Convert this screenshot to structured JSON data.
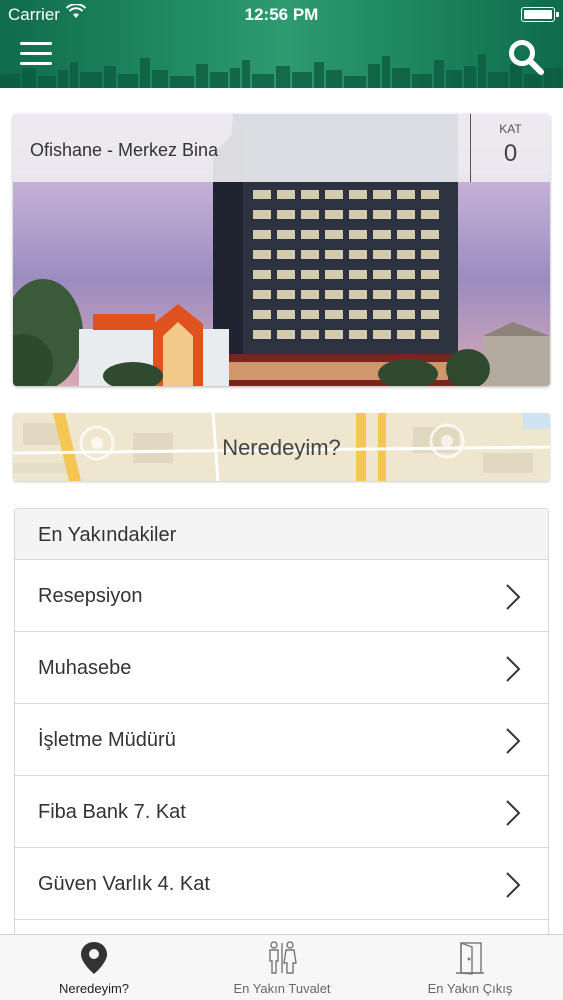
{
  "status_bar": {
    "carrier": "Carrier",
    "time": "12:56 PM"
  },
  "header": {
    "menu_icon": "hamburger-icon",
    "search_icon": "search-icon"
  },
  "building": {
    "name": "Ofishane - Merkez Bina",
    "floor_label": "KAT",
    "floor_value": "0"
  },
  "where_banner": {
    "label": "Neredeyim?"
  },
  "nearest": {
    "title": "En Yakındakiler",
    "items": [
      {
        "label": "Resepsiyon"
      },
      {
        "label": "Muhasebe"
      },
      {
        "label": "İşletme Müdürü"
      },
      {
        "label": "Fiba Bank 7. Kat"
      },
      {
        "label": "Güven Varlık 4. Kat"
      }
    ]
  },
  "tabbar": {
    "tabs": [
      {
        "label": "Neredeyim?",
        "icon": "location-pin-icon",
        "active": true
      },
      {
        "label": "En Yakın Tuvalet",
        "icon": "restroom-icon",
        "active": false
      },
      {
        "label": "En Yakın Çıkış",
        "icon": "exit-door-icon",
        "active": false
      }
    ]
  },
  "colors": {
    "header_green": "#1f8a62",
    "accent_text": "#333333"
  }
}
